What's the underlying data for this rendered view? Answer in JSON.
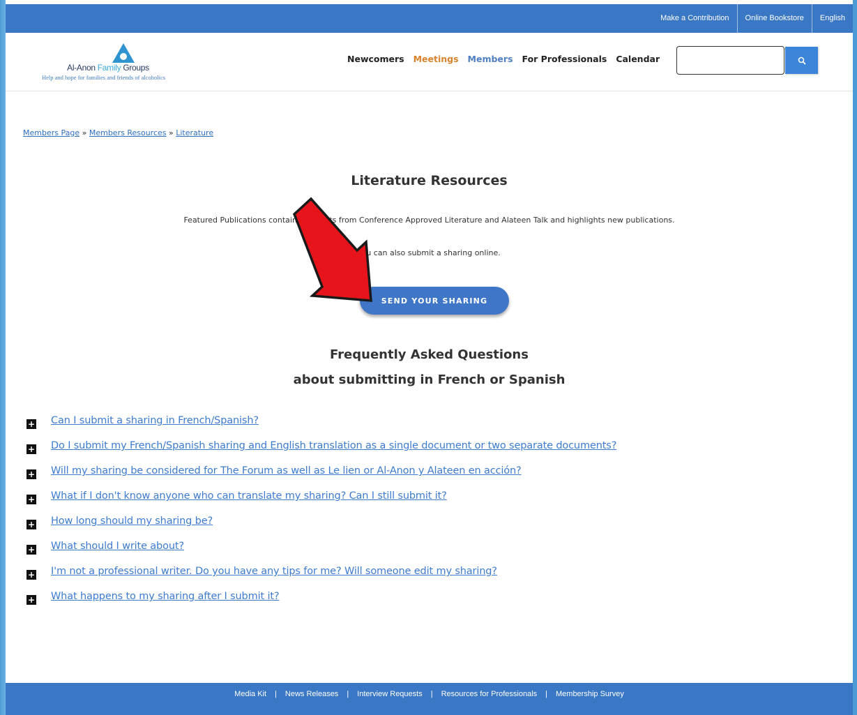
{
  "topbar": {
    "links": [
      "Make a Contribution",
      "Online Bookstore",
      "English"
    ]
  },
  "logo": {
    "name_part1": "Al-Anon ",
    "name_part2": "Family",
    "name_part3": " Groups",
    "tagline": "Help and hope for families and friends of alcoholics"
  },
  "nav": {
    "items": [
      "Newcomers",
      "Meetings",
      "Members",
      "For Professionals",
      "Calendar"
    ]
  },
  "search": {
    "value": "",
    "icon": "search-icon"
  },
  "breadcrumb": {
    "items": [
      "Members Page",
      "Members Resources",
      "Literature"
    ],
    "separator": "»"
  },
  "main": {
    "title": "Literature Resources",
    "intro_before": "Featured Publications contains ",
    "intro_hidden": "excerpts",
    "intro_after": " from Conference Approved Literature and Alateen Talk and highlights new publications.",
    "intro2": "You can also submit a sharing online.",
    "send_button": "SEND YOUR SHARING"
  },
  "faq": {
    "title_line1": "Frequently Asked Questions",
    "title_line2": "about submitting in French or Spanish",
    "toggle_symbol": "+",
    "items": [
      "Can I submit a sharing in French/Spanish?",
      "Do I submit my French/Spanish sharing and English translation as a single document or two separate documents?",
      "Will my sharing be considered for The Forum as well as Le lien or Al-Anon y Alateen en acción?",
      "What if I don't know anyone who can translate my sharing? Can I still submit it?",
      "How long should my sharing be?",
      "What should I write about?",
      "I'm not a professional writer. Do you have any tips for me? Will someone edit my sharing?",
      "What happens to my sharing after I submit it?"
    ]
  },
  "footer": {
    "links": [
      "Media Kit",
      "News Releases",
      "Interview Requests",
      "Resources for Professionals",
      "Membership Survey"
    ],
    "separator": "|"
  },
  "colors": {
    "brand_blue": "#3a77c4",
    "link_blue": "#3d7bd0",
    "meetings_orange": "#d9822b",
    "annotation_arrow": "#e8141c"
  }
}
